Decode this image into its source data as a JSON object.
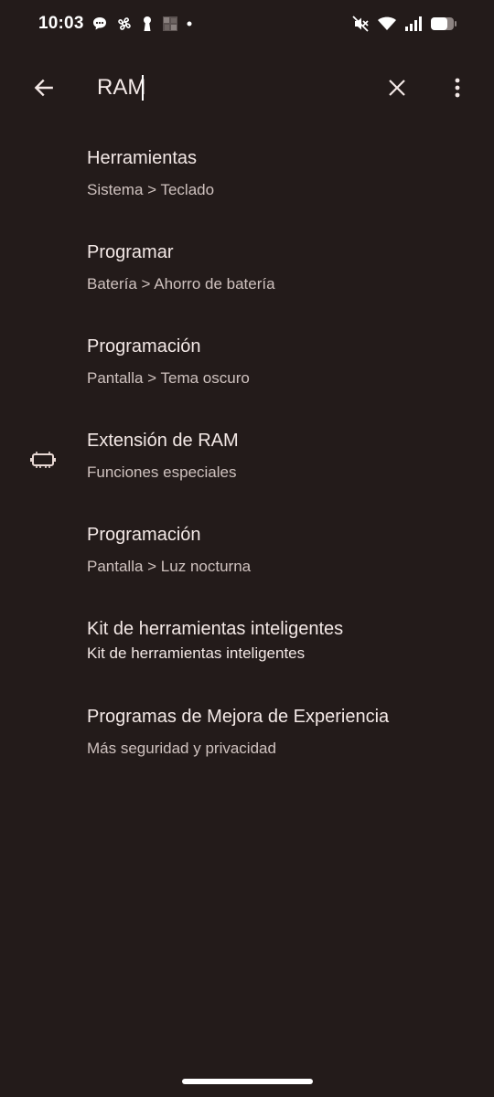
{
  "status_bar": {
    "time": "10:03",
    "left_icons": [
      "chat-bubble-icon",
      "pinwheel-icon",
      "keyhole-icon",
      "image-thumbnail-icon",
      "dot-icon"
    ],
    "right_icons": [
      "vibrate-off-icon",
      "wifi-icon",
      "signal-icon",
      "battery-icon"
    ]
  },
  "search": {
    "query": "RAM"
  },
  "results": [
    {
      "title": "Herramientas",
      "subtitle": "Sistema > Teclado"
    },
    {
      "title": "Programar",
      "subtitle": "Batería > Ahorro de batería"
    },
    {
      "title": "Programación",
      "subtitle": "Pantalla > Tema oscuro"
    },
    {
      "title": "Extensión de RAM",
      "subtitle": "Funciones especiales",
      "icon": "memory-chip-icon"
    },
    {
      "title": "Programación",
      "subtitle": "Pantalla > Luz nocturna"
    },
    {
      "title": "Kit de herramientas inteligentes",
      "subtitle": "Kit de herramientas inteligentes"
    },
    {
      "title": "Programas de Mejora de Experiencia",
      "subtitle": "Más seguridad y privacidad"
    }
  ],
  "colors": {
    "background": "#231b1a",
    "primary_text": "#f3e8e6",
    "secondary_text": "#cfc2bf"
  }
}
